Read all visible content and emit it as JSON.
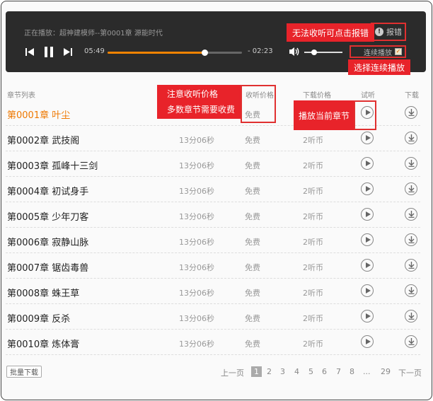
{
  "player": {
    "now_playing_label": "正在播放：",
    "now_playing_title": "超神建模师--第0001章 源能时代",
    "elapsed": "05:49",
    "remaining": "- 02:23",
    "progress": 0.72,
    "volume": 0.25,
    "continuous_label": "连续播放",
    "continuous_checked": true,
    "report_label": "报错"
  },
  "callouts": {
    "report": "无法收听可点击报错",
    "continuous": "选择连续播放",
    "price_line1": "注意收听价格",
    "price_line2": "多数章节需要收费",
    "play": "播放当前章节"
  },
  "table": {
    "headers": {
      "chapter": "章节列表",
      "listen_price": "收听价格",
      "download_price": "下载价格",
      "preview": "试听",
      "download": "下载"
    },
    "rows": [
      {
        "title": "第0001章 叶尘",
        "duration": "",
        "listen_price": "免费",
        "download_price": "",
        "current": true
      },
      {
        "title": "第0002章 武技阁",
        "duration": "13分06秒",
        "listen_price": "免费",
        "download_price": "2听币",
        "current": false
      },
      {
        "title": "第0003章 孤峰十三剑",
        "duration": "13分06秒",
        "listen_price": "免费",
        "download_price": "2听币",
        "current": false
      },
      {
        "title": "第0004章 初试身手",
        "duration": "13分06秒",
        "listen_price": "免费",
        "download_price": "2听币",
        "current": false
      },
      {
        "title": "第0005章 少年刀客",
        "duration": "13分06秒",
        "listen_price": "免费",
        "download_price": "2听币",
        "current": false
      },
      {
        "title": "第0006章 寂静山脉",
        "duration": "13分06秒",
        "listen_price": "免费",
        "download_price": "2听币",
        "current": false
      },
      {
        "title": "第0007章 锯齿毒兽",
        "duration": "13分06秒",
        "listen_price": "免费",
        "download_price": "2听币",
        "current": false
      },
      {
        "title": "第0008章 蛛王草",
        "duration": "13分06秒",
        "listen_price": "免费",
        "download_price": "2听币",
        "current": false
      },
      {
        "title": "第0009章 反杀",
        "duration": "13分06秒",
        "listen_price": "免费",
        "download_price": "2听币",
        "current": false
      },
      {
        "title": "第0010章 炼体膏",
        "duration": "13分06秒",
        "listen_price": "免费",
        "download_price": "2听币",
        "current": false
      }
    ]
  },
  "footer": {
    "batch_download": "批量下载",
    "prev": "上一页",
    "pages": [
      "1",
      "2",
      "3",
      "4",
      "5",
      "6",
      "7",
      "8",
      "...",
      "29"
    ],
    "current_page": "1",
    "next": "下一页"
  },
  "colors": {
    "accent": "#f08300",
    "callout": "#e8232a",
    "player_bg": "#2b2b2b"
  }
}
